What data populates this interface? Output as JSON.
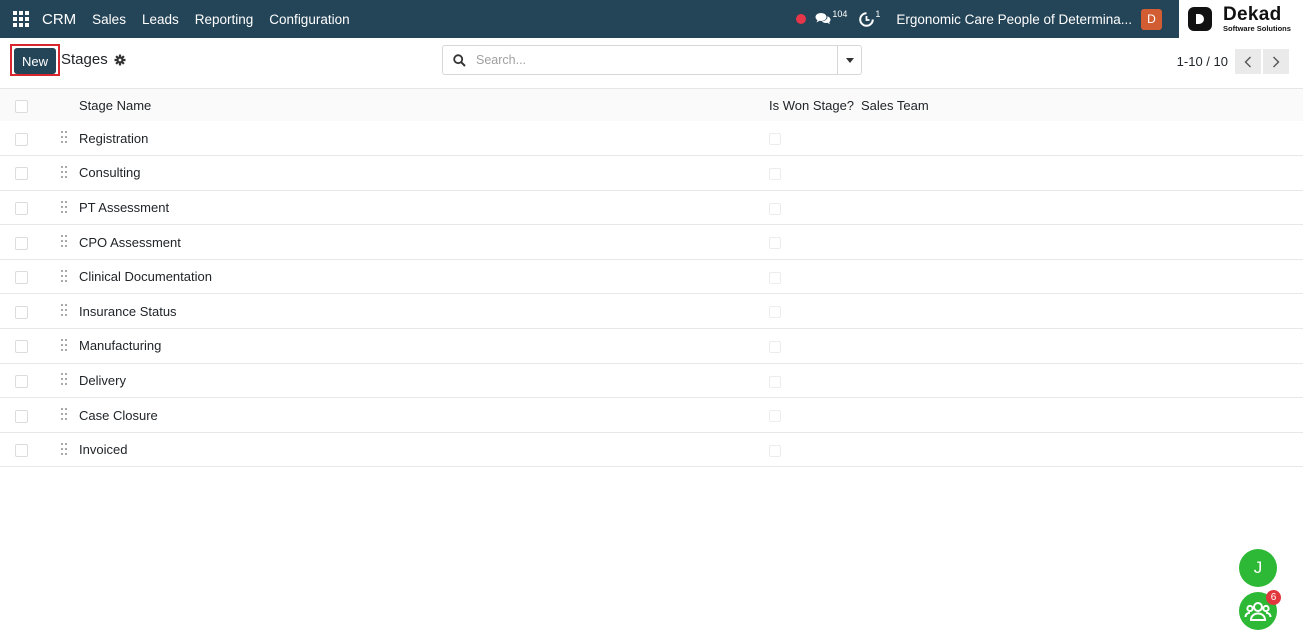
{
  "navbar": {
    "app_name": "CRM",
    "menu": [
      "Sales",
      "Leads",
      "Reporting",
      "Configuration"
    ],
    "messages_count": "104",
    "activities_count": "1",
    "company_name": "Ergonomic Care People of Determina...",
    "user_initial": "D",
    "brand_title": "Dekad",
    "brand_subtitle": "Software Solutions",
    "colors": {
      "navbar": "#244457",
      "record": "#e5364a",
      "avatar": "#d35d33"
    }
  },
  "control_panel": {
    "new_label": "New",
    "title": "Stages",
    "search_placeholder": "Search...",
    "pager_value": "1-10 / 10"
  },
  "table": {
    "headers": {
      "name": "Stage Name",
      "won": "Is Won Stage?",
      "team": "Sales Team"
    },
    "rows": [
      {
        "name": "Registration",
        "won": false,
        "team": ""
      },
      {
        "name": "Consulting",
        "won": false,
        "team": ""
      },
      {
        "name": "PT Assessment",
        "won": false,
        "team": ""
      },
      {
        "name": "CPO Assessment",
        "won": false,
        "team": ""
      },
      {
        "name": "Clinical Documentation",
        "won": false,
        "team": ""
      },
      {
        "name": "Insurance Status",
        "won": false,
        "team": ""
      },
      {
        "name": "Manufacturing",
        "won": false,
        "team": ""
      },
      {
        "name": "Delivery",
        "won": false,
        "team": ""
      },
      {
        "name": "Case Closure",
        "won": false,
        "team": ""
      },
      {
        "name": "Invoiced",
        "won": false,
        "team": ""
      }
    ]
  },
  "floating": {
    "user_initial": "J",
    "team_badge": "6",
    "colors": {
      "bubble": "#2db836",
      "badge": "#e0363c"
    }
  }
}
